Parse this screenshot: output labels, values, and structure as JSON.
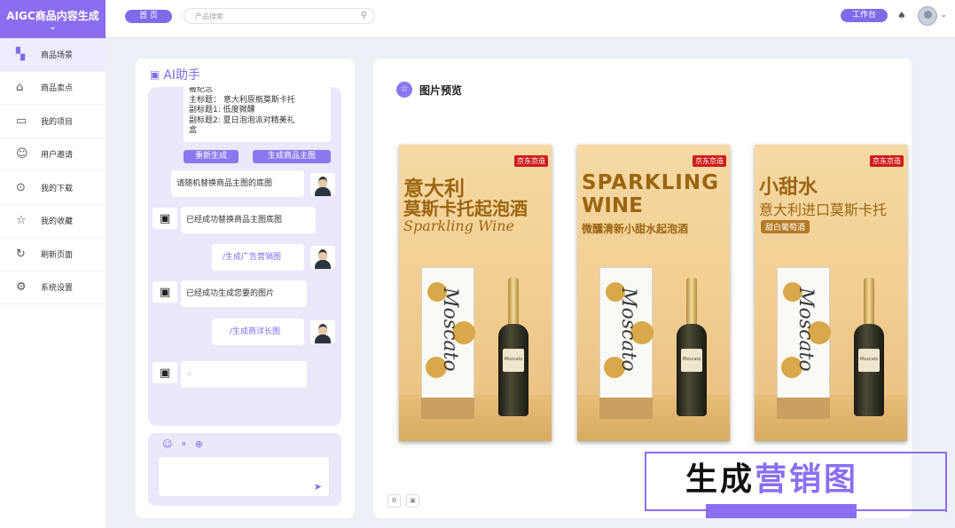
{
  "brand": {
    "title": "AIGC商品内容生成",
    "chevron": "⌄"
  },
  "topbar": {
    "home": "首 页",
    "search_placeholder": "产品搜索",
    "workbench": "工作台"
  },
  "sidebar": {
    "items": [
      {
        "label": "商品场景",
        "icon": "grid-icon",
        "glyph": "▚"
      },
      {
        "label": "商品卖点",
        "icon": "store-icon",
        "glyph": "⌂"
      },
      {
        "label": "我的项目",
        "icon": "folder-icon",
        "glyph": "▭"
      },
      {
        "label": "用户邀请",
        "icon": "user-add-icon",
        "glyph": "☺"
      },
      {
        "label": "我的下载",
        "icon": "download-icon",
        "glyph": "⊙"
      },
      {
        "label": "我的收藏",
        "icon": "star-icon",
        "glyph": "☆"
      },
      {
        "label": "刷新页面",
        "icon": "refresh-icon",
        "glyph": "↻"
      },
      {
        "label": "系统设置",
        "icon": "gear-icon",
        "glyph": "⚙"
      }
    ]
  },
  "chat": {
    "title": "AI助手",
    "first_bubble": [
      "被纪念",
      "主标题：  意大利原瓶莫斯卡托",
      "副标题1: 低度微醺",
      "副标题2: 夏日泡泡派对精美礼",
      "盒"
    ],
    "regenerate": "重新生成",
    "generate_main": "生成商品主图",
    "messages": [
      {
        "role": "user",
        "text": "请随机替换商品主图的底图"
      },
      {
        "role": "bot",
        "text": "已经成功替换商品主图底图"
      },
      {
        "role": "user",
        "text": "/生成广告营销图"
      },
      {
        "role": "bot",
        "text": "已经成功生成您要的图片"
      },
      {
        "role": "user",
        "text": "/生成商详长图"
      },
      {
        "role": "bot",
        "text": "⁘"
      }
    ]
  },
  "preview": {
    "title": "图片预览",
    "posters": [
      {
        "badge": "京东京造",
        "line1": "意大利",
        "line2": "莫斯卡托起泡酒",
        "line3": "Sparkling Wine",
        "tag": "",
        "box": "Moscato",
        "bottle": "Moscato"
      },
      {
        "badge": "京东京造",
        "line1": "SPARKLING",
        "line2": "WINE",
        "line3": "微醺清新小甜水起泡酒",
        "tag": "",
        "box": "Moscato",
        "bottle": "Moscato"
      },
      {
        "badge": "京东京造",
        "line1": "小甜水",
        "line2": "意大利进口莫斯卡托",
        "line3": "",
        "tag": "甜白葡萄酒",
        "box": "Moscato",
        "bottle": "Moscato"
      }
    ]
  },
  "banner": {
    "black": "生成",
    "purple": "营销图"
  },
  "colors": {
    "accent": "#8b6ef0",
    "gold_text": "#9b6512",
    "jd_red": "#d01c1c"
  }
}
